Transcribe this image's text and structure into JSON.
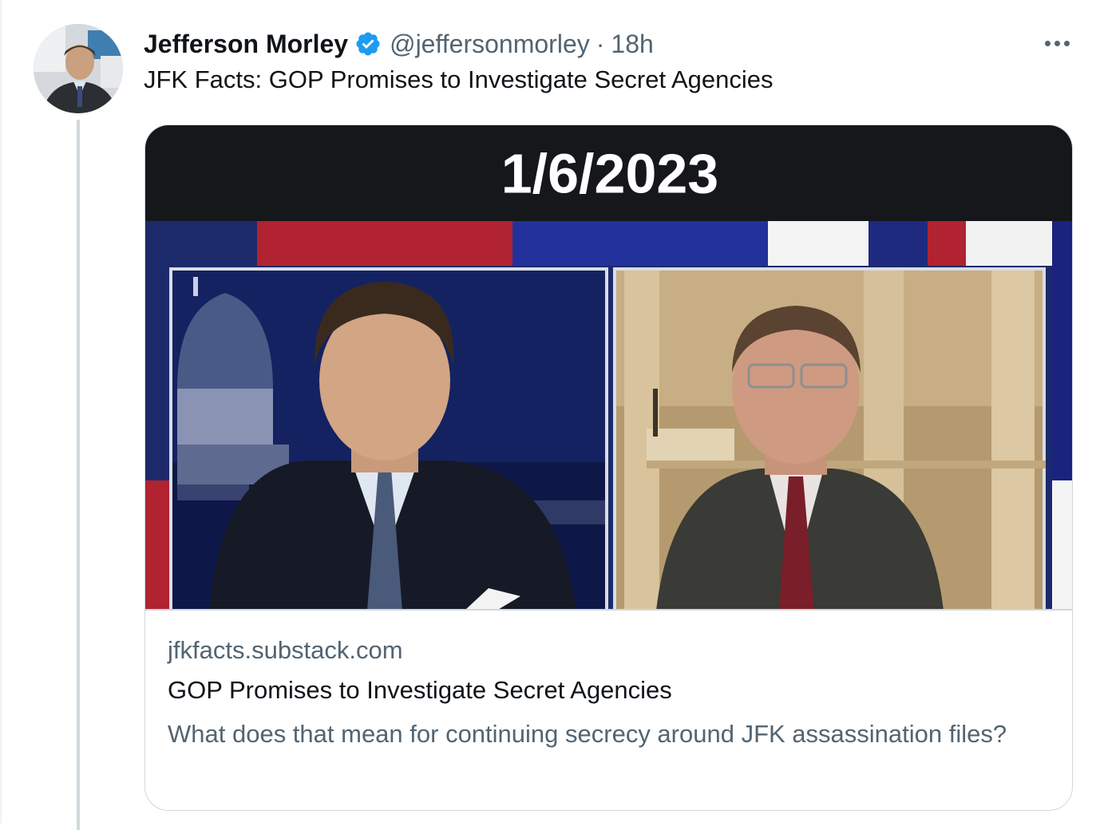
{
  "author": {
    "display_name": "Jefferson Morley",
    "handle": "@jeffersonmorley",
    "separator": "·",
    "timestamp": "18h",
    "verified": true
  },
  "tweet": {
    "text": "JFK Facts: GOP Promises to Investigate Secret Agencies"
  },
  "card": {
    "date_banner": "1/6/2023",
    "domain": "jfkfacts.substack.com",
    "title": "GOP Promises to Investigate Secret Agencies",
    "description": "What does that mean for continuing secrecy around JFK assassination files?"
  },
  "icons": {
    "verified": "verified-badge-icon",
    "more": "more-options-icon"
  },
  "colors": {
    "verified_blue": "#1d9bf0",
    "text_primary": "#0f1419",
    "text_secondary": "#536471",
    "border": "#cfd9de"
  }
}
